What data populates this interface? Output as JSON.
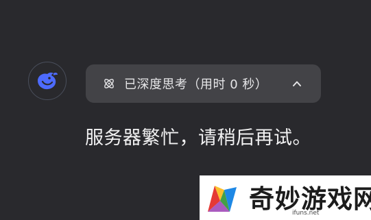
{
  "thinking": {
    "label": "已深度思考（用时 0 秒）",
    "icon": "atom-icon",
    "toggle_icon": "chevron-up-icon"
  },
  "message": {
    "text": "服务器繁忙，请稍后再试。"
  },
  "avatar": {
    "icon": "deepseek-whale-icon",
    "color": "#4d6bfe"
  },
  "watermark": {
    "brand": "奇妙游戏网",
    "url": "ifuns.net"
  }
}
